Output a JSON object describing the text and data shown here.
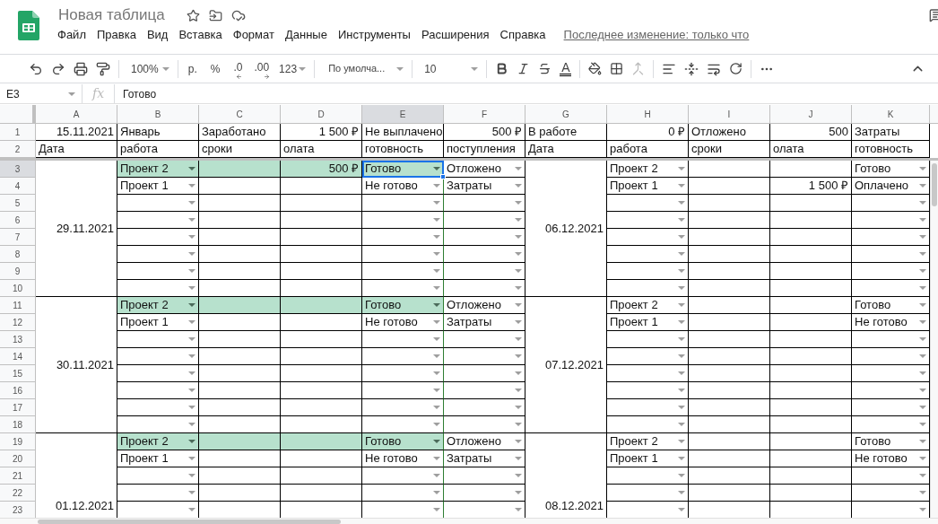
{
  "document": {
    "title": "Новая таблица",
    "last_edit": "Последнее изменение: только что"
  },
  "menu": [
    "Файл",
    "Правка",
    "Вид",
    "Вставка",
    "Формат",
    "Данные",
    "Инструменты",
    "Расширения",
    "Справка"
  ],
  "toolbar": {
    "zoom": "100%",
    "currency": "р.",
    "percent": "%",
    "decrease_decimals": ".0",
    "increase_decimals": ".00",
    "number_format": "123",
    "font": "По умолча...",
    "font_size": "10",
    "text_color": "A"
  },
  "formula_bar": {
    "name_box": "E3",
    "label": "fx",
    "value": "Готово"
  },
  "columns": [
    {
      "letter": "A",
      "kind": "date"
    },
    {
      "letter": "B",
      "kind": "dropdown"
    },
    {
      "letter": "C",
      "kind": "text"
    },
    {
      "letter": "D",
      "kind": "text"
    },
    {
      "letter": "E",
      "kind": "dropdown"
    },
    {
      "letter": "F",
      "kind": "dropdown"
    },
    {
      "letter": "G",
      "kind": "date"
    },
    {
      "letter": "H",
      "kind": "dropdown"
    },
    {
      "letter": "I",
      "kind": "text"
    },
    {
      "letter": "J",
      "kind": "text"
    },
    {
      "letter": "K",
      "kind": "dropdown"
    }
  ],
  "top_rows": [
    {
      "number": "1",
      "cells": {
        "A": {
          "text": "15.11.2021",
          "right": true
        },
        "B": {
          "text": "Январь"
        },
        "C": {
          "text": "Заработано"
        },
        "D": {
          "text": "1 500 ₽",
          "right": true
        },
        "E": {
          "text": "Не выплачено"
        },
        "F": {
          "text": "500 ₽",
          "right": true
        },
        "G": {
          "text": "В работе"
        },
        "H": {
          "text": "0 ₽",
          "right": true
        },
        "I": {
          "text": "Отложено"
        },
        "J": {
          "text": "500",
          "right": true
        },
        "K": {
          "text": "Затраты"
        }
      }
    },
    {
      "number": "2",
      "cells": {
        "A": {
          "text": "Дата"
        },
        "B": {
          "text": "работа"
        },
        "C": {
          "text": "сроки"
        },
        "D": {
          "text": "олата"
        },
        "E": {
          "text": "готовность"
        },
        "F": {
          "text": "поступления"
        },
        "G": {
          "text": "Дата"
        },
        "H": {
          "text": "работа"
        },
        "I": {
          "text": "сроки"
        },
        "J": {
          "text": "олата"
        },
        "K": {
          "text": "готовность"
        }
      }
    }
  ],
  "blocks": [
    {
      "left_date": "29.11.2021",
      "right_date": "06.12.2021",
      "rows": [
        {
          "number": "3",
          "cells": {
            "B": {
              "text": "Проект 2",
              "highlighted": true
            },
            "C": {
              "highlighted": true
            },
            "D": {
              "text": "500 ₽",
              "right": true,
              "highlighted": true
            },
            "E": {
              "text": "Готово",
              "highlighted": true,
              "selected": true
            },
            "F": {
              "text": "Отложено"
            },
            "H": {
              "text": "Проект 2"
            },
            "K": {
              "text": "Готово"
            }
          }
        },
        {
          "number": "4",
          "cells": {
            "B": {
              "text": "Проект 1"
            },
            "E": {
              "text": "Не готово"
            },
            "F": {
              "text": "Затраты"
            },
            "H": {
              "text": "Проект 1"
            },
            "J": {
              "text": "1 500 ₽",
              "right": true
            },
            "K": {
              "text": "Оплачено"
            }
          }
        },
        {
          "number": "5"
        },
        {
          "number": "6"
        },
        {
          "number": "7"
        },
        {
          "number": "8"
        },
        {
          "number": "9"
        },
        {
          "number": "10"
        }
      ]
    },
    {
      "left_date": "30.11.2021",
      "right_date": "07.12.2021",
      "rows": [
        {
          "number": "11",
          "cells": {
            "B": {
              "text": "Проект 2",
              "highlighted": true
            },
            "C": {
              "highlighted": true
            },
            "D": {
              "highlighted": true
            },
            "E": {
              "text": "Готово",
              "highlighted": true
            },
            "F": {
              "text": "Отложено"
            },
            "H": {
              "text": "Проект 2"
            },
            "K": {
              "text": "Готово"
            }
          }
        },
        {
          "number": "12",
          "cells": {
            "B": {
              "text": "Проект 1"
            },
            "E": {
              "text": "Не готово"
            },
            "F": {
              "text": "Затраты"
            },
            "H": {
              "text": "Проект 1"
            },
            "K": {
              "text": "Не готово"
            }
          }
        },
        {
          "number": "13"
        },
        {
          "number": "14"
        },
        {
          "number": "15"
        },
        {
          "number": "16"
        },
        {
          "number": "17"
        },
        {
          "number": "18"
        }
      ]
    },
    {
      "left_date": "01.12.2021",
      "right_date": "08.12.2021",
      "rows": [
        {
          "number": "19",
          "cells": {
            "B": {
              "text": "Проект 2",
              "highlighted": true
            },
            "C": {
              "highlighted": true
            },
            "D": {
              "highlighted": true
            },
            "E": {
              "text": "Готово",
              "highlighted": true
            },
            "F": {
              "text": "Отложено"
            },
            "H": {
              "text": "Проект 2"
            },
            "K": {
              "text": "Готово"
            }
          }
        },
        {
          "number": "20",
          "cells": {
            "B": {
              "text": "Проект 1"
            },
            "E": {
              "text": "Не готово"
            },
            "F": {
              "text": "Затраты"
            },
            "H": {
              "text": "Проект 1"
            },
            "K": {
              "text": "Не готово"
            }
          }
        },
        {
          "number": "21"
        },
        {
          "number": "22"
        },
        {
          "number": "23"
        }
      ]
    }
  ]
}
